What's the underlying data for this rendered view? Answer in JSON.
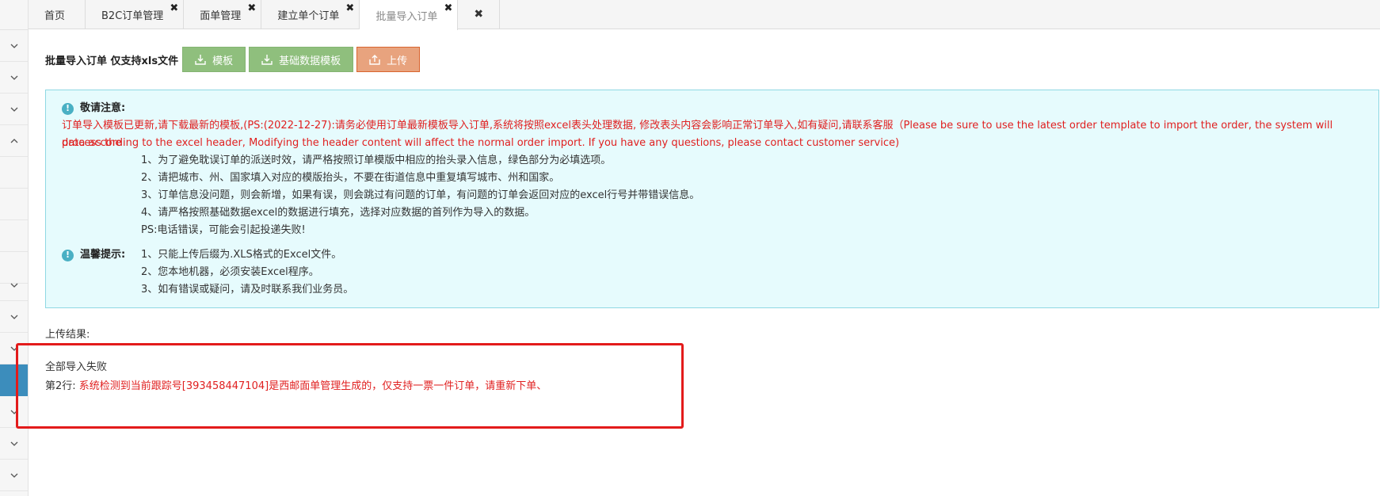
{
  "tabs": [
    {
      "label": "首页",
      "closable": false,
      "active": false
    },
    {
      "label": "B2C订单管理",
      "closable": true,
      "active": false
    },
    {
      "label": "面单管理",
      "closable": true,
      "active": false
    },
    {
      "label": "建立单个订单",
      "closable": true,
      "active": false
    },
    {
      "label": "批量导入订单",
      "closable": true,
      "active": true
    }
  ],
  "tab_close_symbol": "✖",
  "toolbar": {
    "title": "批量导入订单 仅支持xls文件",
    "template_label": "模板",
    "base_template_label": "基础数据模板",
    "upload_label": "上传"
  },
  "notice": {
    "title": "敬请注意:",
    "warning_line1": "订单导入模板已更新,请下载最新的模板,(PS:(2022-12-27):请务必使用订单最新模板导入订单,系统将按照excel表头处理数据, 修改表头内容会影响正常订单导入,如有疑问,请联系客服（Please be sure to use the latest order template to import the order, the system will process the",
    "warning_line2": "data according to the excel header, Modifying the header content will affect the normal order import. If you have any questions, please contact customer service)",
    "items": [
      "1、为了避免耽误订单的派送时效，请严格按照订单模版中相应的抬头录入信息，绿色部分为必填选项。",
      "2、请把城市、州、国家填入对应的模版抬头，不要在街道信息中重复填写城市、州和国家。",
      "3、订单信息没问题，则会新增，如果有误，则会跳过有问题的订单，有问题的订单会返回对应的excel行号并带错误信息。",
      "4、请严格按照基础数据excel的数据进行填充，选择对应数据的首列作为导入的数据。",
      "PS:电话错误，可能会引起投递失败!"
    ]
  },
  "tips": {
    "title": "温馨提示:",
    "items": [
      "1、只能上传后缀为.XLS格式的Excel文件。",
      "2、您本地机器，必须安装Excel程序。",
      "3、如有错误或疑问，请及时联系我们业务员。"
    ]
  },
  "result": {
    "label": "上传结果:",
    "status": "全部导入失败",
    "row_prefix": "第2行:",
    "row_message": "系统检测到当前跟踪号[393458447104]是西邮面单管理生成的，仅支持一票一件订单，请重新下单、"
  },
  "colors": {
    "button_green": "#8fbf7d",
    "upload_button": "#e8a37e",
    "notice_bg": "#e6fbfd",
    "warning_red": "#e02020",
    "highlight_red": "#e31b1b",
    "sidebar_active": "#3c8dbc"
  }
}
